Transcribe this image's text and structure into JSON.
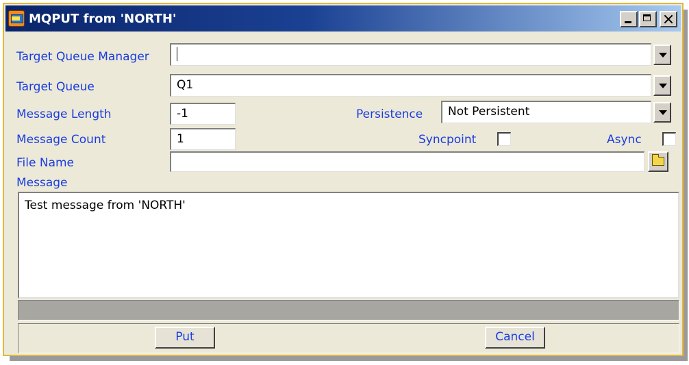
{
  "window": {
    "title": "MQPUT from 'NORTH'",
    "controls": {
      "minimize": "minimize",
      "maximize": "maximize",
      "close": "close"
    }
  },
  "form": {
    "target_queue_manager": {
      "label": "Target Queue Manager",
      "value": ""
    },
    "target_queue": {
      "label": "Target Queue",
      "value": "Q1"
    },
    "message_length": {
      "label": "Message Length",
      "value": "-1"
    },
    "persistence": {
      "label": "Persistence",
      "value": "Not Persistent"
    },
    "message_count": {
      "label": "Message Count",
      "value": "1"
    },
    "syncpoint": {
      "label": "Syncpoint",
      "checked": false
    },
    "async": {
      "label": "Async",
      "checked": false
    },
    "file_name": {
      "label": "File Name",
      "value": ""
    },
    "message": {
      "label": "Message",
      "value": "Test message from 'NORTH'"
    }
  },
  "buttons": {
    "put": "Put",
    "cancel": "Cancel"
  },
  "icons": {
    "app": "mq-app-icon",
    "browse": "folder-icon",
    "dropdown": "chevron-down-icon"
  },
  "colors": {
    "label": "#1a3de0",
    "title_start": "#0a246a",
    "title_end": "#a6caf0",
    "window_border": "#e3b83a",
    "background": "#ece9d8"
  }
}
